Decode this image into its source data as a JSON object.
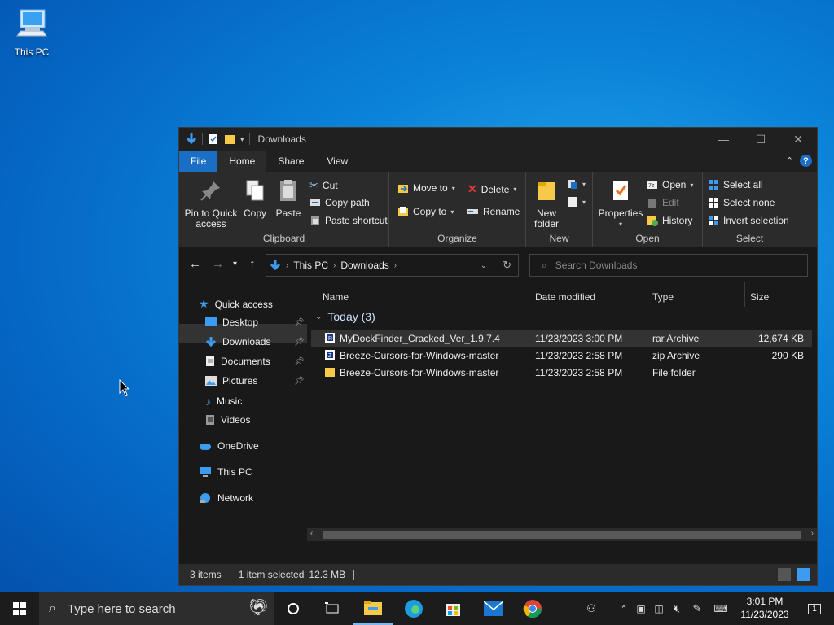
{
  "desktop": {
    "icon_label": "This PC"
  },
  "window": {
    "title": "Downloads",
    "tabs": {
      "file": "File",
      "home": "Home",
      "share": "Share",
      "view": "View"
    },
    "ribbon": {
      "clipboard": {
        "name": "Clipboard",
        "pin": "Pin to Quick access",
        "pin_l1": "Pin to Quick",
        "pin_l2": "access",
        "copy": "Copy",
        "paste": "Paste",
        "cut": "Cut",
        "copy_path": "Copy path",
        "paste_shortcut": "Paste shortcut"
      },
      "organize": {
        "name": "Organize",
        "move_to": "Move to",
        "copy_to": "Copy to",
        "delete": "Delete",
        "rename": "Rename"
      },
      "new": {
        "name": "New",
        "new_folder_l1": "New",
        "new_folder_l2": "folder"
      },
      "open": {
        "name": "Open",
        "properties": "Properties",
        "open": "Open",
        "edit": "Edit",
        "history": "History"
      },
      "select": {
        "name": "Select",
        "select_all": "Select all",
        "select_none": "Select none",
        "invert": "Invert selection"
      }
    },
    "address": {
      "segments": [
        "This PC",
        "Downloads"
      ]
    },
    "search": {
      "placeholder": "Search Downloads"
    },
    "nav": {
      "quick_access": "Quick access",
      "desktop": "Desktop",
      "downloads": "Downloads",
      "documents": "Documents",
      "pictures": "Pictures",
      "music": "Music",
      "videos": "Videos",
      "onedrive": "OneDrive",
      "this_pc": "This PC",
      "network": "Network"
    },
    "columns": {
      "name": "Name",
      "date": "Date modified",
      "type": "Type",
      "size": "Size"
    },
    "group_header": "Today (3)",
    "files": [
      {
        "name": "MyDockFinder_Cracked_Ver_1.9.7.4",
        "date": "11/23/2023 3:00 PM",
        "type": "rar Archive",
        "size": "12,674 KB",
        "selected": true
      },
      {
        "name": "Breeze-Cursors-for-Windows-master",
        "date": "11/23/2023 2:58 PM",
        "type": "zip Archive",
        "size": "290 KB",
        "selected": false
      },
      {
        "name": "Breeze-Cursors-for-Windows-master",
        "date": "11/23/2023 2:58 PM",
        "type": "File folder",
        "size": "",
        "selected": false
      }
    ],
    "status": {
      "items": "3 items",
      "selected": "1 item selected",
      "size": "12.3 MB"
    }
  },
  "taskbar": {
    "search_placeholder": "Type here to search",
    "time": "3:01 PM",
    "date": "11/23/2023",
    "notification_count": "1"
  }
}
